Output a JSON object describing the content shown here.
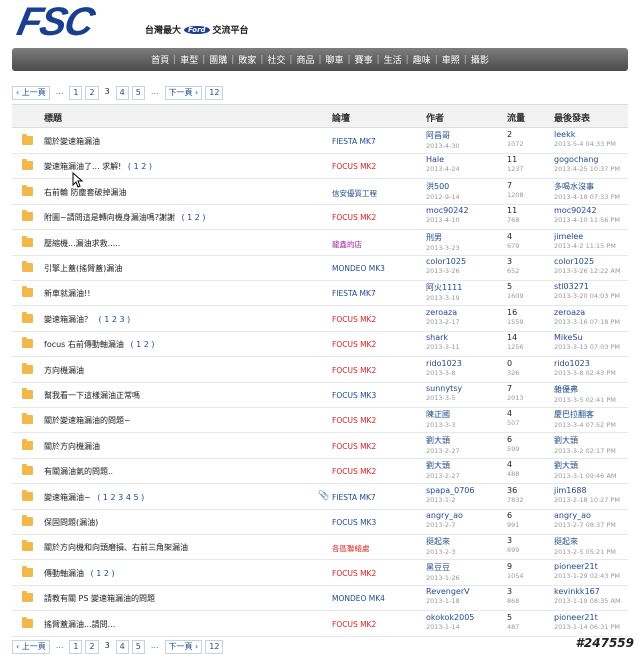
{
  "header": {
    "logo": "FSC",
    "subtitle_left": "台灣最大",
    "ford": "Ford",
    "subtitle_right": "交流平台"
  },
  "nav": [
    "首頁",
    "車型",
    "團購",
    "敗家",
    "社交",
    "商品",
    "聊車",
    "賽事",
    "生活",
    "趣味",
    "車照",
    "攝影"
  ],
  "pager": {
    "prev": "‹ 上一頁",
    "pages": [
      "1",
      "2",
      "3",
      "4",
      "5"
    ],
    "current": "3",
    "dots": "...",
    "next": "下一頁 ›",
    "last": "12"
  },
  "columns": {
    "title": "標題",
    "forum": "論壇",
    "author": "作者",
    "stats": "流量",
    "last": "最後發表"
  },
  "colors": {
    "forum_blue": "#1f4a8a",
    "forum_red": "#d62020",
    "forum_purple": "#a020a0"
  },
  "rows": [
    {
      "title": "關於變速箱漏油",
      "pages": "",
      "forum": "FIESTA MK7",
      "forum_color": "#1f4a8a",
      "author": "阿昌哥",
      "adate": "2013-4-30",
      "replies": "2",
      "views": "1072",
      "last": "leekk",
      "ldate": "2013-5-4 04:33 PM",
      "clip": false
    },
    {
      "title": "變速箱漏油了... 求解! ",
      "pages": "( 1 2 )",
      "forum": "FOCUS MK2",
      "forum_color": "#d62020",
      "author": "Hale",
      "adate": "2013-4-24",
      "replies": "11",
      "views": "1237",
      "last": "gogochang",
      "ldate": "2013-4-25 10:37 PM",
      "clip": false
    },
    {
      "title": "右前輪 防塵套破掉漏油",
      "pages": "",
      "forum": "信安優質工程",
      "forum_color": "#1f4a8a",
      "author": "洪500",
      "adate": "2012-9-14",
      "replies": "7",
      "views": "1208",
      "last": "多喝水沒事",
      "ldate": "2013-4-18 07:33 PM",
      "clip": false
    },
    {
      "title": "附圖~請問這是轉向機身漏油嗎?謝謝 ",
      "pages": "( 1 2 )",
      "forum": "FOCUS MK2",
      "forum_color": "#d62020",
      "author": "moc90242",
      "adate": "2013-4-10",
      "replies": "11",
      "views": "768",
      "last": "moc90242",
      "ldate": "2013-4-10 11:56 PM",
      "clip": false
    },
    {
      "title": "壓縮機...漏油求救.....",
      "pages": "",
      "forum": "龍鑫的店",
      "forum_color": "#a020a0",
      "author": "刑男",
      "adate": "2013-3-23",
      "replies": "4",
      "views": "679",
      "last": "jimelee",
      "ldate": "2013-4-2 11:15 PM",
      "clip": false
    },
    {
      "title": "引擎上蓋(搖臂蓋)漏油",
      "pages": "",
      "forum": "MONDEO MK3",
      "forum_color": "#1f4a8a",
      "author": "color1025",
      "adate": "2013-3-26",
      "replies": "3",
      "views": "652",
      "last": "color1025",
      "ldate": "2013-3-26 12:22 AM",
      "clip": false
    },
    {
      "title": "新車就漏油!!",
      "pages": "",
      "forum": "FIESTA MK7",
      "forum_color": "#1f4a8a",
      "author": "阿火1111",
      "adate": "2013-3-19",
      "replies": "5",
      "views": "1609",
      "last": "stl03271",
      "ldate": "2013-3-20 04:03 PM",
      "clip": false
    },
    {
      "title": "變速箱漏油？ ",
      "pages": "( 1 2 3 )",
      "forum": "FOCUS MK2",
      "forum_color": "#d62020",
      "author": "zeroaza",
      "adate": "2013-2-17",
      "replies": "16",
      "views": "1559",
      "last": "zeroaza",
      "ldate": "2013-3-16 07:18 PM",
      "clip": false
    },
    {
      "title": "focus 右前傳動軸漏油 ",
      "pages": "( 1 2 )",
      "forum": "FOCUS MK2",
      "forum_color": "#d62020",
      "author": "shark",
      "adate": "2013-3-11",
      "replies": "14",
      "views": "1256",
      "last": "MikeSu",
      "ldate": "2013-3-13 07:03 PM",
      "clip": false
    },
    {
      "title": "方向機漏油",
      "pages": "",
      "forum": "FOCUS MK2",
      "forum_color": "#d62020",
      "author": "rido1023",
      "adate": "2013-3-8",
      "replies": "0",
      "views": "326",
      "last": "rido1023",
      "ldate": "2013-3-8 02:43 PM",
      "clip": false
    },
    {
      "title": "幫我看一下這樣漏油正常嗎",
      "pages": "",
      "forum": "FOCUS MK3",
      "forum_color": "#1f4a8a",
      "author": "sunnytsy",
      "adate": "2013-3-5",
      "replies": "7",
      "views": "2013",
      "last": "雜優弗",
      "ldate": "2013-3-5 02:41 PM",
      "clip": false
    },
    {
      "title": "關於變速箱漏油的問題~",
      "pages": "",
      "forum": "FOCUS MK2",
      "forum_color": "#d62020",
      "author": "陳正國",
      "adate": "2013-3-3",
      "replies": "4",
      "views": "507",
      "last": "慶巴拉翻客",
      "ldate": "2013-3-4 07:52 PM",
      "clip": false
    },
    {
      "title": "關於方向機漏油",
      "pages": "",
      "forum": "FOCUS MK2",
      "forum_color": "#d62020",
      "author": "劉大頭",
      "adate": "2013-2-27",
      "replies": "6",
      "views": "599",
      "last": "劉大頭",
      "ldate": "2013-3-2 02:17 PM",
      "clip": false
    },
    {
      "title": "有關漏油氣的問題..",
      "pages": "",
      "forum": "FOCUS MK2",
      "forum_color": "#d62020",
      "author": "劉大頭",
      "adate": "2013-2-27",
      "replies": "4",
      "views": "488",
      "last": "劉大頭",
      "ldate": "2013-3-1 09:46 AM",
      "clip": false
    },
    {
      "title": "變速箱漏油~ ",
      "pages": "( 1 2 3 4 5 )",
      "forum": "FIESTA MK7",
      "forum_color": "#1f4a8a",
      "author": "spapa_0706",
      "adate": "2013-1-2",
      "replies": "36",
      "views": "7832",
      "last": "jim1688",
      "ldate": "2013-2-18 10:27 PM",
      "clip": true
    },
    {
      "title": "保固問題(漏油)",
      "pages": "",
      "forum": "FOCUS MK3",
      "forum_color": "#1f4a8a",
      "author": "angry_ao",
      "adate": "2013-2-7",
      "replies": "6",
      "views": "991",
      "last": "angry_ao",
      "ldate": "2013-2-7 08:37 PM",
      "clip": false
    },
    {
      "title": "關於方向機和向頭磨損、右前三角架漏油",
      "pages": "",
      "forum": "各區聯絡處",
      "forum_color": "#d62020",
      "author": "挺起來",
      "adate": "2013-2-3",
      "replies": "3",
      "views": "699",
      "last": "挺起來",
      "ldate": "2013-2-5 05:21 PM",
      "clip": false
    },
    {
      "title": "傳動軸漏油 ",
      "pages": "( 1 2 )",
      "forum": "FOCUS MK2",
      "forum_color": "#d62020",
      "author": "黑豆豆",
      "adate": "2013-1-26",
      "replies": "9",
      "views": "1054",
      "last": "pioneer21t",
      "ldate": "2013-1-29 02:43 PM",
      "clip": false
    },
    {
      "title": "請教有關 PS 變速箱漏油的問題",
      "pages": "",
      "forum": "MONDEO MK4",
      "forum_color": "#1f4a8a",
      "author": "RevengerV",
      "adate": "2013-1-18",
      "replies": "3",
      "views": "868",
      "last": "kevinkk167",
      "ldate": "2013-1-19 08:35 AM",
      "clip": false
    },
    {
      "title": "搖臂蓋漏油...請問...",
      "pages": "",
      "forum": "FOCUS MK2",
      "forum_color": "#d62020",
      "author": "okokok2005",
      "adate": "2013-1-14",
      "replies": "5",
      "views": "487",
      "last": "pioneer21t",
      "ldate": "2013-1-14 06:31 PM",
      "clip": false
    }
  ],
  "watermark": "#247559"
}
